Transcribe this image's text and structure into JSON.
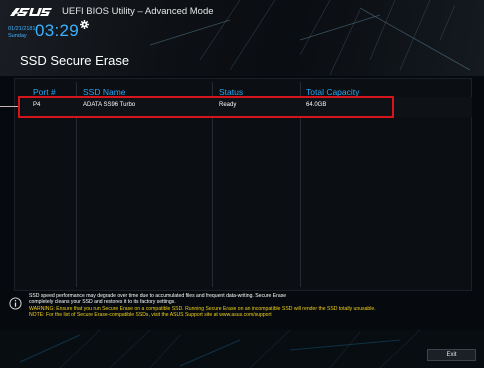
{
  "header": {
    "logo_text": "/ISUS",
    "app_title": "UEFI BIOS Utility – Advanced Mode",
    "date": "01/21/2181",
    "day": "Sunday",
    "time": "03:29",
    "settings_icon": "gear-icon"
  },
  "page": {
    "title": "SSD Secure Erase"
  },
  "table": {
    "columns": [
      "Port #",
      "SSD Name",
      "Status",
      "Total Capacity"
    ],
    "rows": [
      {
        "port": "P4",
        "name": "ADATA SS96 Turbo",
        "status": "Ready",
        "capacity": "64.0GB"
      }
    ]
  },
  "info": {
    "icon": "info-icon",
    "line1": "SSD speed performance may degrade over time due to accumulated files and frequent data-writing. Secure Erase",
    "line2": "completely cleans your SSD and restores it to its factory settings.",
    "line3": "WARNING: Ensure that you run Secure Erase on a compatible SSD. Running Secure Erase on an incompatible SSD will render the SSD totally unusable.",
    "line4": "NOTE: For the list of Secure Erase-compatible SSDs, visit the ASUS Support site at www.asus.com/support"
  },
  "footer": {
    "exit_label": "Exit"
  },
  "colors": {
    "accent": "#2ba7f5",
    "highlight": "#d6141c",
    "warning": "#f2d21a"
  }
}
